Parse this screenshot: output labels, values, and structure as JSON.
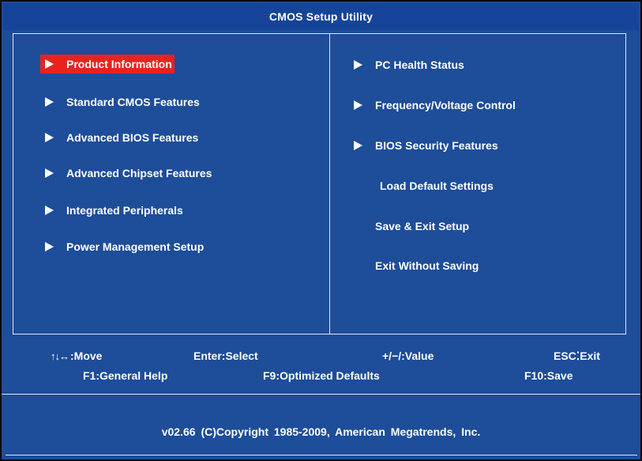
{
  "title": "CMOS Setup Utility",
  "left_menu": [
    {
      "label": "Product Information",
      "selected": true
    },
    {
      "label": "Standard CMOS Features",
      "selected": false
    },
    {
      "label": "Advanced BIOS Features",
      "selected": false
    },
    {
      "label": "Advanced Chipset Features",
      "selected": false
    },
    {
      "label": "Integrated Peripherals",
      "selected": false
    },
    {
      "label": "Power Management Setup",
      "selected": false
    }
  ],
  "right_menu": [
    {
      "label": "PC Health Status",
      "has_submenu": true
    },
    {
      "label": "Frequency/Voltage Control",
      "has_submenu": true
    },
    {
      "label": "BIOS Security Features",
      "has_submenu": true
    },
    {
      "label": "Load Default Settings",
      "has_submenu": false
    },
    {
      "label": "Save & Exit Setup",
      "has_submenu": false
    },
    {
      "label": "Exit Without Saving",
      "has_submenu": false
    }
  ],
  "help": {
    "move_icon": "↑↓↔",
    "move": ":Move",
    "select": "Enter:Select",
    "value": "+/−/:Value",
    "exit": "ESC⁚Exit",
    "general_help": "F1:General Help",
    "optimized_defaults": "F9:Optimized Defaults",
    "save": "F10:Save"
  },
  "copyright": "v02.66 (C)Copyright 1985-2009, American Megatrends, Inc.",
  "colors": {
    "background": "#1e4d99",
    "highlight": "#e8231e",
    "text": "#ffffff"
  }
}
